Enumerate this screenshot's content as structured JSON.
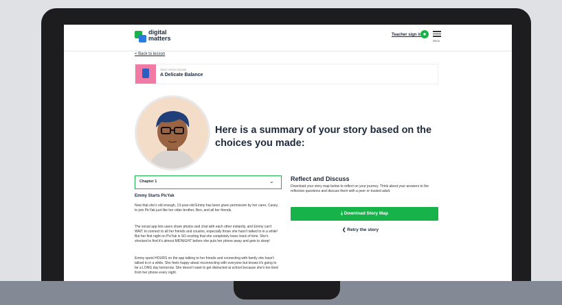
{
  "header": {
    "logo_line1": "digital",
    "logo_line2": "matters",
    "teacher_link": "Teacher sign in",
    "menu_label": "MENU",
    "user_icon": "user-icon",
    "menu_icon": "hamburger-icon"
  },
  "nav": {
    "back_link": "< Back to lesson"
  },
  "lesson": {
    "eyebrow": "ONCE UPON ONLINE",
    "title": "A Delicate Balance"
  },
  "summary": {
    "title": "Here is a summary of your story based on the choices you made:"
  },
  "chapter": {
    "selected": "Chapter 1",
    "story_title": "Emmy Starts PicYak",
    "paragraphs": [
      "Now that she's old enough, 13-year-old Emmy has been given permission by her carer, Casey, to join PicYak just like her older brother, Ben, and all her friends.",
      "The social app lets users share photos and chat with each other instantly, and Emmy can't WAIT to connect to all her friends and cousins, especially those she hasn't talked to in a while! But her first night on PicYak is SO exciting that she completely loses track of time. She's shocked to find it's almost MIDNIGHT before she puts her phone away and gets to sleep!",
      "Emmy spent HOURS on the app talking to her friends and connecting with family she hasn't talked to in a while. She feels happy about reconnecting with everyone but knows it's going to be a LONG day tomorrow. She doesn't want to get distracted at school because she's too tired from her phone every night."
    ]
  },
  "reflect": {
    "title": "Reflect and Discuss",
    "text": "Download your story map below to reflect on your journey. Think about your answers to the reflection questions and discuss them with a peer or trusted adult.",
    "download_label": "⤓  Download Story Map",
    "retry_label": "❮  Retry the story"
  },
  "colors": {
    "accent": "#17b34a",
    "brand_blue": "#2b7be0",
    "text": "#1d2a3a"
  }
}
